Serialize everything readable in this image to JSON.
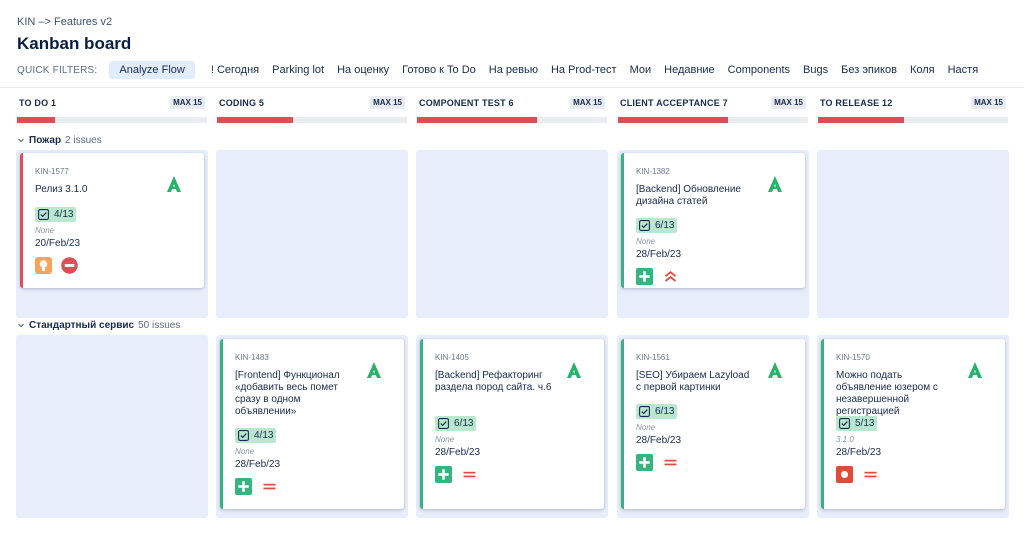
{
  "breadcrumb": "KIN –> Features v2",
  "page_title": "Kanban board",
  "quick_filters": {
    "label": "QUICK FILTERS:",
    "items": [
      "Analyze Flow",
      "! Сегодня",
      "Parking lot",
      "На оценку",
      "Готово к To Do",
      "На ревью",
      "На Prod-тест",
      "Мои",
      "Недавние",
      "Components",
      "Bugs",
      "Без эпиков",
      "Коля",
      "Настя"
    ],
    "active": "Analyze Flow"
  },
  "columns": [
    {
      "title": "TO DO 1",
      "max": "MAX 15",
      "fill_fraction": 0.2
    },
    {
      "title": "CODING 5",
      "max": "MAX 15",
      "fill_fraction": 0.4
    },
    {
      "title": "COMPONENT TEST 6",
      "max": "MAX 15",
      "fill_fraction": 0.63
    },
    {
      "title": "CLIENT ACCEPTANCE 7",
      "max": "MAX 15",
      "fill_fraction": 0.58
    },
    {
      "title": "TO RELEASE 12",
      "max": "MAX 15",
      "fill_fraction": 0.45
    }
  ],
  "swimlanes": [
    {
      "name": "Пожар",
      "count": "2 issues",
      "cards": [
        {
          "key": "KIN-1577",
          "summary": "Релиз 3.1.0",
          "subtasks": "4/13",
          "fix": "None",
          "date": "20/Feb/23",
          "border": "red",
          "icons": [
            "improvement-icon",
            "blocker-icon"
          ]
        },
        null,
        null,
        {
          "key": "KIN-1382",
          "summary": "[Backend] Обновление дизайна статей",
          "subtasks": "6/13",
          "fix": "None",
          "date": "28/Feb/23",
          "border": "green",
          "icons": [
            "new-feature-icon",
            "priority-highest-icon"
          ]
        },
        null
      ]
    },
    {
      "name": "Стандартный сервис",
      "count": "50 issues",
      "cards": [
        null,
        {
          "key": "KIN-1483",
          "summary": "[Frontend] Функционал «добавить весь помет сразу в одном объявлении»",
          "subtasks": "4/13",
          "fix": "None",
          "date": "28/Feb/23",
          "border": "green",
          "icons": [
            "new-feature-icon",
            "priority-medium-icon"
          ]
        },
        {
          "key": "KIN-1405",
          "summary": "[Backend] Рефакторинг раздела пород сайта. ч.6",
          "subtasks": "6/13",
          "fix": "None",
          "date": "28/Feb/23",
          "border": "green",
          "icons": [
            "new-feature-icon",
            "priority-medium-icon"
          ]
        },
        {
          "key": "KIN-1561",
          "summary": "[SEO] Убираем Lazyload с первой картинки",
          "subtasks": "6/13",
          "fix": "None",
          "date": "28/Feb/23",
          "border": "green",
          "icons": [
            "new-feature-icon",
            "priority-medium-icon"
          ]
        },
        {
          "key": "KIN-1570",
          "summary": "Можно подать объявление юзером с незавершенной регистрацией",
          "subtasks": "5/13",
          "fix": "3.1.0",
          "date": "28/Feb/23",
          "border": "green",
          "icons": [
            "bug-icon",
            "priority-medium-icon"
          ]
        }
      ]
    }
  ],
  "colors": {
    "accent_green": "#36b37e",
    "accent_red": "#de4f55",
    "cell_bg": "#e8edfb",
    "subtask_bg": "#b9e8cf"
  }
}
